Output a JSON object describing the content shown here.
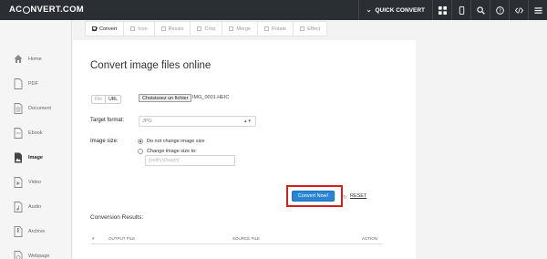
{
  "header": {
    "logo_left": "AC",
    "logo_right": "NVERT.COM",
    "quick_convert": "QUICK CONVERT"
  },
  "sidebar": {
    "items": [
      {
        "label": "Home",
        "icon": "home-icon"
      },
      {
        "label": "PDF",
        "icon": "file-icon"
      },
      {
        "label": "Document",
        "icon": "document-icon"
      },
      {
        "label": "Ebook",
        "icon": "ebook-icon"
      },
      {
        "label": "Image",
        "icon": "image-icon",
        "active": true
      },
      {
        "label": "Video",
        "icon": "video-icon"
      },
      {
        "label": "Audio",
        "icon": "audio-icon"
      },
      {
        "label": "Archive",
        "icon": "archive-icon"
      },
      {
        "label": "Webpage",
        "icon": "webpage-icon"
      }
    ]
  },
  "tabs": [
    {
      "label": "Convert",
      "active": true
    },
    {
      "label": "Icon"
    },
    {
      "label": "Resize"
    },
    {
      "label": "Crop"
    },
    {
      "label": "Merge"
    },
    {
      "label": "Rotate"
    },
    {
      "label": "Effect"
    }
  ],
  "main": {
    "title": "Convert image files online",
    "source_switch": {
      "file": "File",
      "url": "URL"
    },
    "choose_file_label": "Choisissez un fichier",
    "file_name": "IMG_0001.HEIC",
    "target_format_label": "Target format:",
    "target_format_value": "JPG",
    "image_size_label": "Image size:",
    "radio_keep": "Do not change image size",
    "radio_change": "Change image size to:",
    "size_placeholder": "[width]x[height]",
    "convert_button": "Convert Now!",
    "reset": "RESET",
    "results_title": "Conversion Results:",
    "table_headers": {
      "num": "#",
      "output": "OUTPUT FILE",
      "source": "SOURCE FILE",
      "action": "ACTION"
    }
  },
  "colors": {
    "accent": "#2a86d4",
    "highlight": "#d41f1f",
    "topbar": "#2b2f33"
  }
}
